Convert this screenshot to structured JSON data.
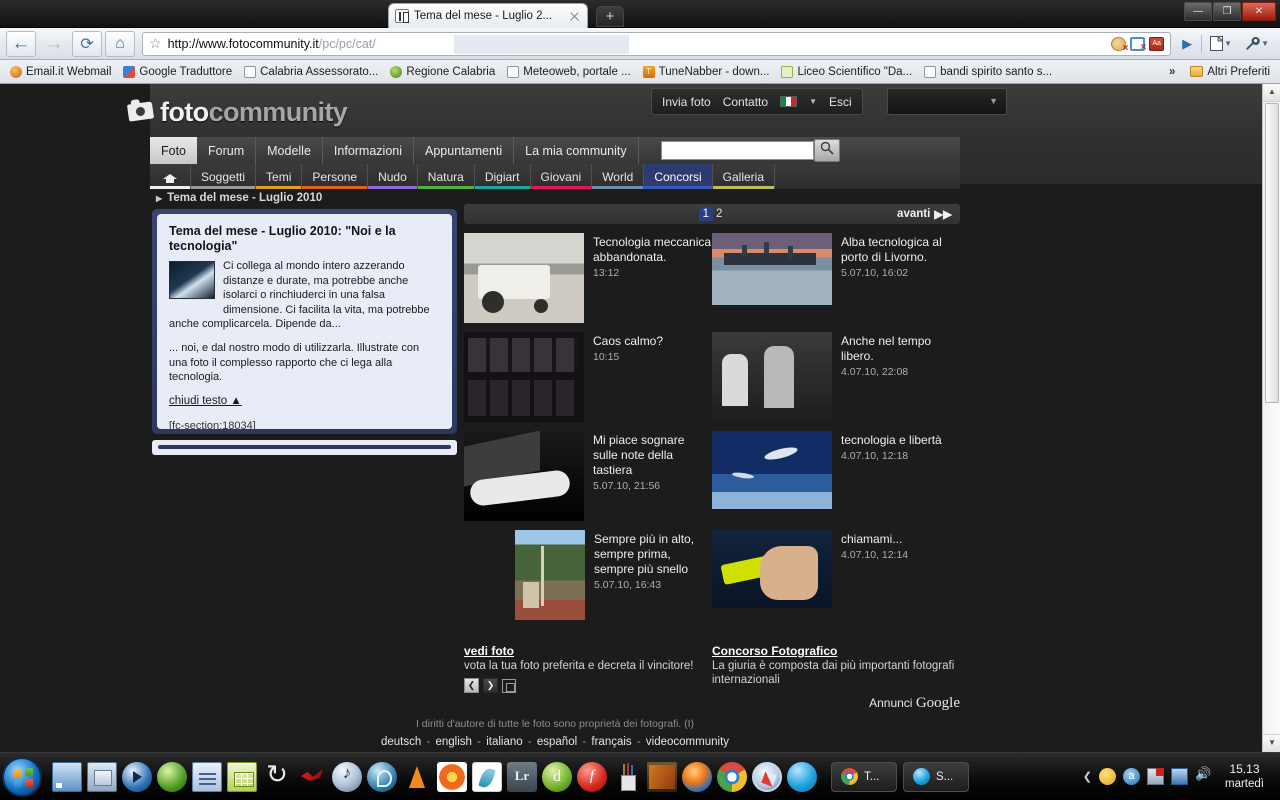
{
  "browser": {
    "tab": {
      "title": "Tema del mese - Luglio 2...",
      "favicon": "fotocommunity-favicon",
      "close": "×"
    },
    "newtab_label": "+",
    "window_controls": {
      "minimize": "—",
      "maximize": "❐",
      "close": "✕"
    },
    "nav": {
      "back": "←",
      "forward": "→",
      "reload": "⟳",
      "home": "⌂",
      "star": "☆"
    },
    "address": {
      "scheme_host": "http://www.fotocommunity.it",
      "path": "/pc/pc/cat/",
      "full": "http://www.fotocommunity.it/pc/pc/cat/"
    },
    "omni_icons": [
      {
        "name": "cookie-blocked-icon",
        "mark": "×"
      },
      {
        "name": "popup-blocked-icon",
        "mark": "×"
      },
      {
        "name": "dictionary-icon",
        "label": "Aa"
      }
    ],
    "go_button": "▶",
    "page_menu": "▼",
    "wrench_menu": "▼",
    "bookmarks": [
      {
        "label": "Email.it Webmail",
        "icon": "mail-icon"
      },
      {
        "label": "Google Traduttore",
        "icon": "google-icon"
      },
      {
        "label": "Calabria Assessorato...",
        "icon": "page-icon"
      },
      {
        "label": "Regione Calabria",
        "icon": "calabria-icon"
      },
      {
        "label": "Meteoweb, portale ...",
        "icon": "page-icon"
      },
      {
        "label": "TuneNabber - down...",
        "icon": "tunenabber-icon"
      },
      {
        "label": "Liceo Scientifico \"Da...",
        "icon": "liceo-icon"
      },
      {
        "label": "bandi spirito santo s...",
        "icon": "page-icon"
      }
    ],
    "bookmarks_overflow": "»",
    "other_bookmarks": "Altri Preferiti"
  },
  "site": {
    "logo": {
      "foto": "foto",
      "community": "community"
    },
    "userbar": {
      "send": "Invia foto",
      "contact": "Contatto",
      "lang_flag": "italian-flag",
      "logout": "Esci"
    },
    "search": {
      "value": "",
      "placeholder": "",
      "button": "search-icon"
    },
    "nav_primary": [
      {
        "label": "Foto",
        "active": true
      },
      {
        "label": "Forum",
        "active": false
      },
      {
        "label": "Modelle",
        "active": false
      },
      {
        "label": "Informazioni",
        "active": false
      },
      {
        "label": "Appuntamenti",
        "active": false
      },
      {
        "label": "La mia community",
        "active": false
      }
    ],
    "nav_secondary": [
      {
        "label": "",
        "icon": "home-icon",
        "color": "#f0f0f0",
        "active": false
      },
      {
        "label": "Soggetti",
        "color": "#9a9a9a",
        "active": false
      },
      {
        "label": "Temi",
        "color": "#e0a020",
        "active": false
      },
      {
        "label": "Persone",
        "color": "#e2621e",
        "active": false
      },
      {
        "label": "Nudo",
        "color": "#8a6fd4",
        "active": false
      },
      {
        "label": "Natura",
        "color": "#4fb03a",
        "active": false
      },
      {
        "label": "Digiart",
        "color": "#1fa8a0",
        "active": false
      },
      {
        "label": "Giovani",
        "color": "#e01858",
        "active": false
      },
      {
        "label": "World",
        "color": "#6f8ba8",
        "active": false
      },
      {
        "label": "Concorsi",
        "color": "#3c5bb5",
        "active": true
      },
      {
        "label": "Galleria",
        "color": "#c3bb62",
        "active": false
      }
    ],
    "breadcrumb": "Tema del mese - Luglio 2010"
  },
  "panel": {
    "heading": "Tema del mese - Luglio 2010: \"Noi e la tecnologia\"",
    "thumb": "panel-thumbnail",
    "paragraph1": "Ci collega al mondo intero azzerando distanze e durate, ma potrebbe anche isolarci o rinchiuderci in una falsa dimensione. Ci facilita la vita, ma potrebbe anche complicarcela. Dipende da...",
    "paragraph2": "... noi, e dal nostro modo di utilizzarla. Illustrate con una foto il complesso rapporto che ci lega alla tecnologia.",
    "close_link": "chiudi testo ▲",
    "section_code": "[fc-section:18034]"
  },
  "pager": {
    "pages": [
      "1",
      "2"
    ],
    "current": "1",
    "next_label": "avanti",
    "next_icon": "▶▶"
  },
  "photos": [
    {
      "title": "Tecnologia meccanica abbandonata.",
      "time": "13:12",
      "thumb": "tractor-bw-photo"
    },
    {
      "title": "Alba tecnologica al porto di Livorno.",
      "time": "5.07.10, 16:02",
      "thumb": "harbour-sunrise-photo"
    },
    {
      "title": "Caos calmo?",
      "time": "10:15",
      "thumb": "keyboard-keys-photo"
    },
    {
      "title": "Anche nel tempo libero.",
      "time": "4.07.10, 22:08",
      "thumb": "people-bw-photo"
    },
    {
      "title": "Mi piace sognare sulle note della tastiera",
      "time": "5.07.10, 21:56",
      "thumb": "keyboard-mouse-photo"
    },
    {
      "title": "tecnologia e libertà",
      "time": "4.07.10, 12:18",
      "thumb": "bird-plane-sky-photo"
    },
    {
      "title": "Sempre più in alto, sempre prima, sempre più snello",
      "time": "5.07.10, 16:43",
      "thumb": "tower-landscape-photo"
    },
    {
      "title": "chiamami...",
      "time": "4.07.10, 12:14",
      "thumb": "hand-phone-photo"
    }
  ],
  "promo": {
    "left": {
      "title": "vedi foto",
      "text": "vota la tua foto preferita e decreta il vincitore!",
      "prev": "❮",
      "next": "❯",
      "expand": "expand-icon"
    },
    "right": {
      "title": "Concorso Fotografico",
      "text": "La giuria è composta dai più importanti fotografi internazionali",
      "ads_label_prefix": "Annunci",
      "ads_label_brand": "Google"
    }
  },
  "footer": {
    "copyright": "I diritti d'autore di tutte le foto sono proprietà dei fotografi. (I)",
    "languages": [
      "deutsch",
      "english",
      "italiano",
      "español",
      "français",
      "videocommunity"
    ],
    "separator": "-"
  },
  "taskbar": {
    "start": "start-orb",
    "quick_launch": [
      "show-desktop-icon",
      "windows-explorer-icon",
      "windows-media-player-icon",
      "windows-media-center-icon",
      "openoffice-writer-icon",
      "openoffice-calc-icon",
      "sync-icon",
      "red-ribbon-icon",
      "itunes-icon",
      "teal-app-icon",
      "vlc-icon",
      "flower-app-icon",
      "feather-app-icon",
      "lightroom-icon",
      "dreamweaver-icon",
      "flash-icon",
      "brush-app-icon",
      "movie-maker-icon",
      "firefox-icon",
      "chrome-icon",
      "safari-icon",
      "skype-icon"
    ],
    "buttons": [
      {
        "label": "T...",
        "icon": "chrome-icon"
      },
      {
        "label": "S...",
        "icon": "skype-icon"
      }
    ],
    "tray": {
      "chevron": "❮",
      "icons": [
        "clock-tray-icon",
        "amazon-tray-icon",
        "network-warning-icon",
        "network-icon",
        "volume-icon"
      ]
    },
    "clock": {
      "time": "15.13",
      "day": "martedì"
    }
  }
}
